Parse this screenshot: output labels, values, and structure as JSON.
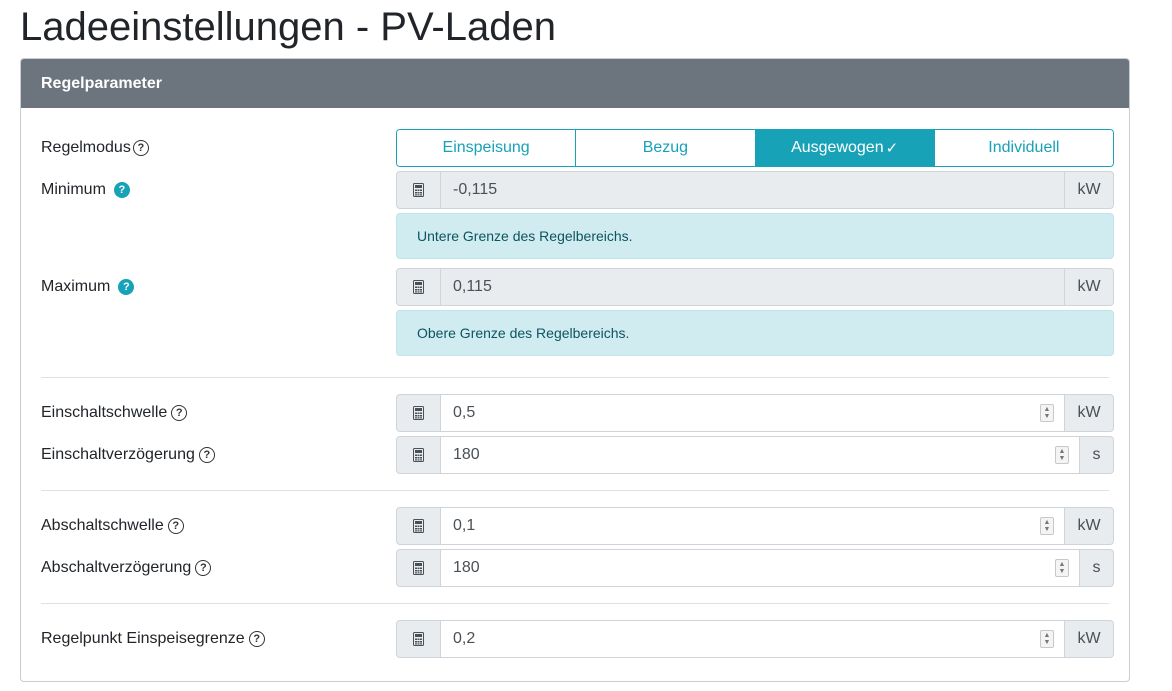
{
  "page": {
    "title": "Ladeeinstellungen - PV-Laden"
  },
  "card": {
    "header": "Regelparameter"
  },
  "mode": {
    "label": "Regelmodus",
    "options": [
      "Einspeisung",
      "Bezug",
      "Ausgewogen",
      "Individuell"
    ],
    "selected": "Ausgewogen",
    "check_glyph": "✓"
  },
  "minimum": {
    "label": "Minimum",
    "value": "-0,115",
    "unit": "kW",
    "info": "Untere Grenze des Regelbereichs."
  },
  "maximum": {
    "label": "Maximum",
    "value": "0,115",
    "unit": "kW",
    "info": "Obere Grenze des Regelbereichs."
  },
  "einschaltschwelle": {
    "label": "Einschaltschwelle",
    "value": "0,5",
    "unit": "kW"
  },
  "einschaltverzoegerung": {
    "label": "Einschaltverzögerung",
    "value": "180",
    "unit": "s"
  },
  "abschaltschwelle": {
    "label": "Abschaltschwelle",
    "value": "0,1",
    "unit": "kW"
  },
  "abschaltverzoegerung": {
    "label": "Abschaltverzögerung",
    "value": "180",
    "unit": "s"
  },
  "regelpunkt": {
    "label": "Regelpunkt Einspeisegrenze",
    "value": "0,2",
    "unit": "kW"
  },
  "icons": {
    "help": "?",
    "calculator": "calculator-icon",
    "spinner": "spin-buttons-icon"
  },
  "colors": {
    "accent": "#17a2b8",
    "header_bg": "#6c757d",
    "info_bg": "#d1ecf1",
    "info_text": "#0c5460"
  }
}
